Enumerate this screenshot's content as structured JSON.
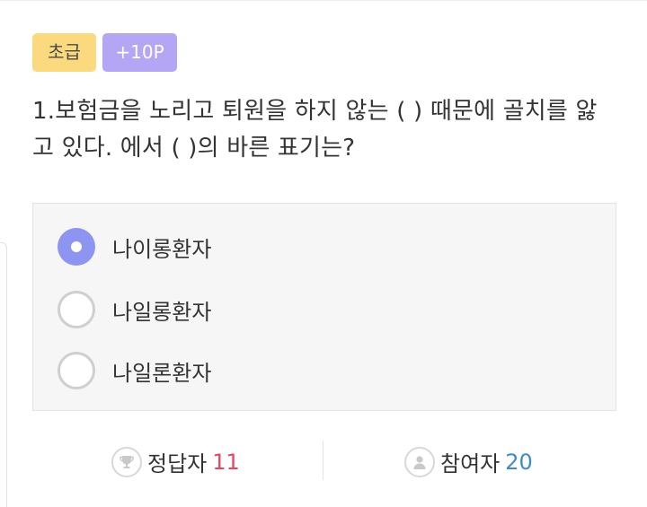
{
  "quiz": {
    "level_badge": "초급",
    "point_badge": "+10P",
    "question": "1.보험금을 노리고 퇴원을 하지 않는 (  ) 때문에 골치를 앓고 있다. 에서 (  )의 바른 표기는?",
    "options": [
      {
        "label": "나이롱환자",
        "selected": true
      },
      {
        "label": "나일롱환자",
        "selected": false
      },
      {
        "label": "나일론환자",
        "selected": false
      }
    ]
  },
  "stats": {
    "correct_label": "정답자",
    "correct_count": "11",
    "participants_label": "참여자",
    "participants_count": "20"
  },
  "colors": {
    "level_badge_bg": "#fbd97f",
    "point_badge_bg": "#b4a5f5",
    "selected_radio": "#8d95f1",
    "correct_count": "#e2495e",
    "participants_count": "#3d8cc8"
  },
  "icons": {
    "correct": "trophy-icon",
    "participants": "user-icon"
  }
}
